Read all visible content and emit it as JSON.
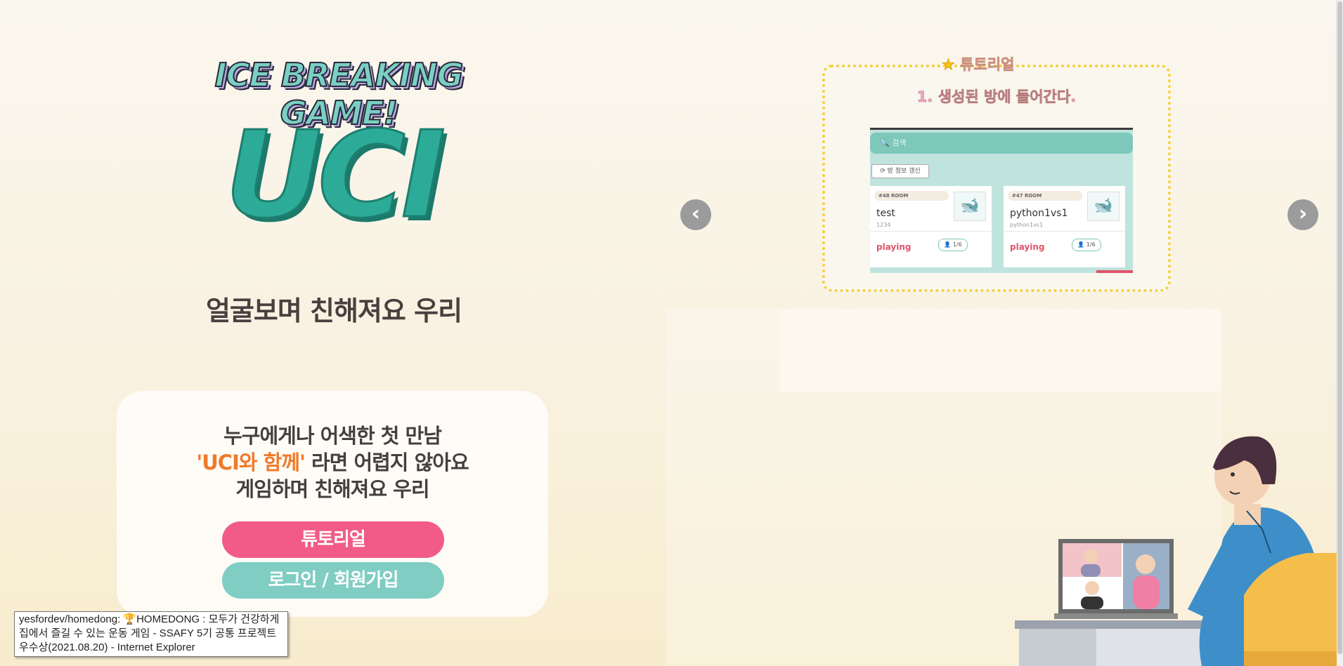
{
  "hero": {
    "game_title": "ICE BREAKING GAME!",
    "brand": "UCI",
    "tagline": "얼굴보며 친해져요 우리"
  },
  "intro_card": {
    "line1": "누구에게나 어색한 첫 만남",
    "line2_accent": "'UCI와 함께'",
    "line2_rest": " 라면 어렵지 않아요",
    "line3": "게임하며 친해져요 우리",
    "tutorial_button": "튜토리얼",
    "login_button": "로그인 / 회원가입"
  },
  "tooltip": {
    "text": "yesfordev/homedong: 🏆HOMEDONG : 모두가 건강하게 집에서 즐길 수 있는 운동 게임 - SSAFY 5기 공통 프로젝트 우수상(2021.08.20) - Internet Explorer"
  },
  "carousel": {
    "prev_symbol": "‹",
    "next_symbol": "›",
    "slide_title_star": "★",
    "slide_title": "튜토리얼",
    "slide_step": "1. 생성된 방에 들어간다.",
    "screenshot": {
      "search_placeholder": "🔍 검색",
      "refresh_label": "⟳ 방 정보 갱신",
      "rooms": [
        {
          "tag": "#48 ROOM",
          "name": "test",
          "sub": "1234",
          "status": "playing",
          "count": "👤 1/6"
        },
        {
          "tag": "#47 ROOM",
          "name": "python1vs1",
          "sub": "python1vs1",
          "status": "playing",
          "count": "👤 1/6"
        }
      ]
    }
  },
  "colors": {
    "accent_teal": "#2cab98",
    "tutorial_pink": "#f25b86",
    "login_teal": "#7fcdc3",
    "accent_orange": "#f07a2b"
  }
}
